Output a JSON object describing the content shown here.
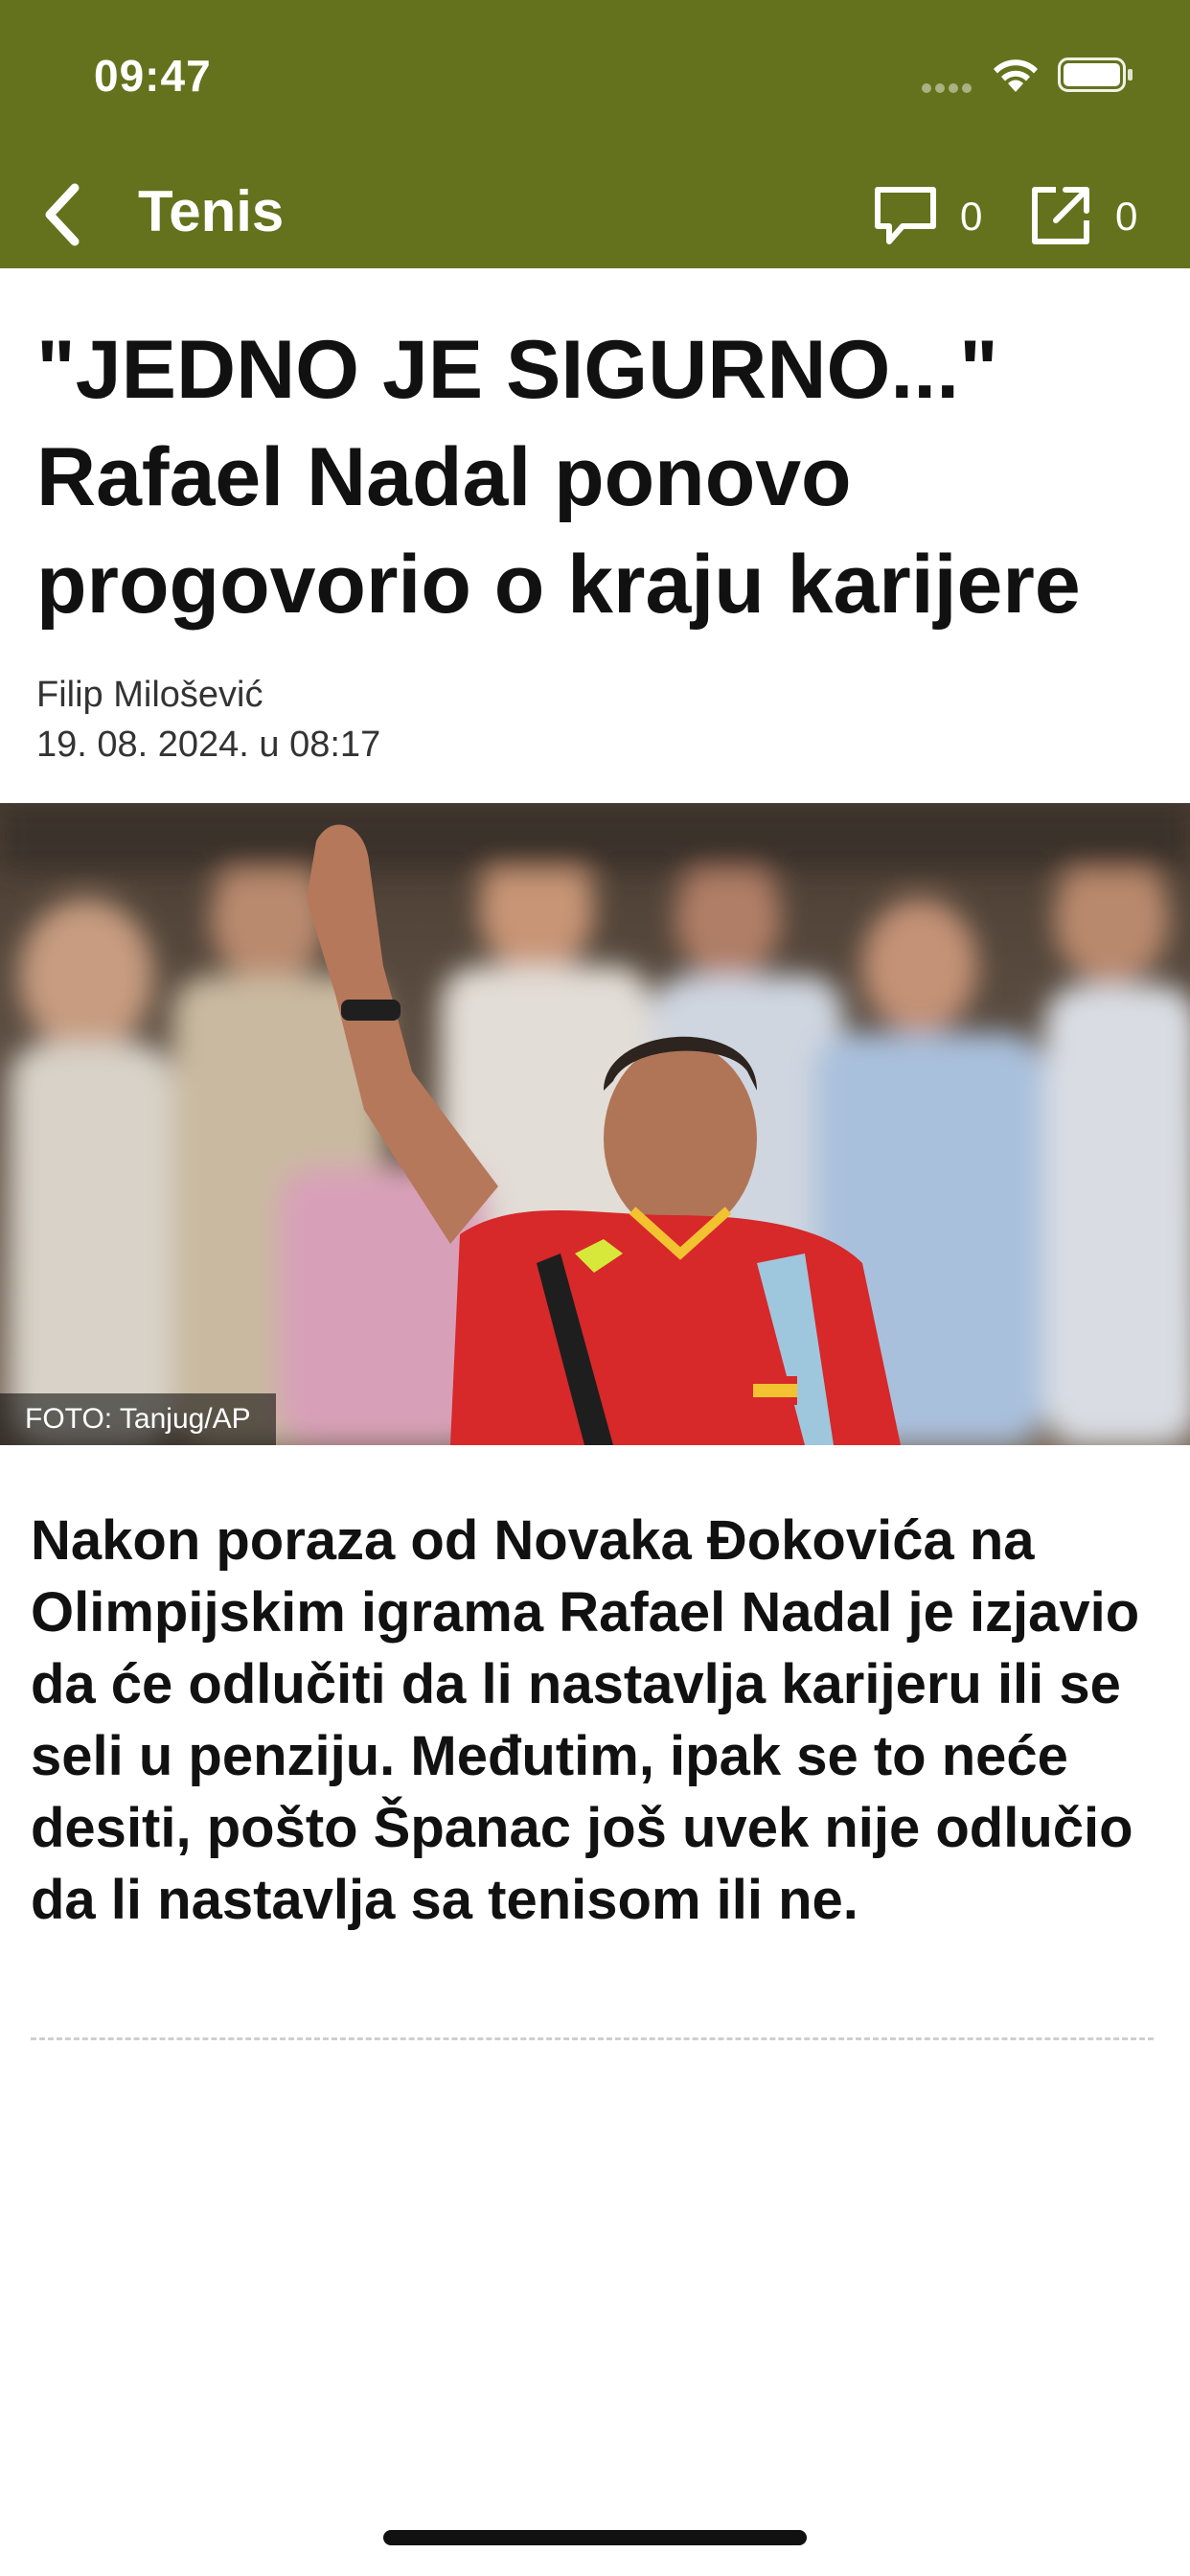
{
  "status_bar": {
    "time": "09:47"
  },
  "nav": {
    "title": "Tenis",
    "comments_count": "0",
    "shares_count": "0",
    "icons": {
      "back": "chevron-left-icon",
      "comments": "speech-bubble-icon",
      "share": "share-external-icon"
    }
  },
  "article": {
    "headline": "\"JEDNO JE SIGURNO...\" Rafael Nadal ponovo progovorio o kraju karijere",
    "author": "Filip Milošević",
    "date": "19. 08. 2024. u 08:17",
    "photo_credit": "FOTO: Tanjug/AP",
    "lead": "Nakon poraza od Novaka Đokovića na Olimpijskim igrama Rafael Nadal je izjavio da će odlučiti da li nastavlja karijeru ili se seli u penziju. Međutim, ipak se to neće desiti, pošto Španac još uvek nije odlučio da li nastavlja sa tenisom ili ne."
  },
  "colors": {
    "accent": "#65721d",
    "text": "#111111"
  }
}
